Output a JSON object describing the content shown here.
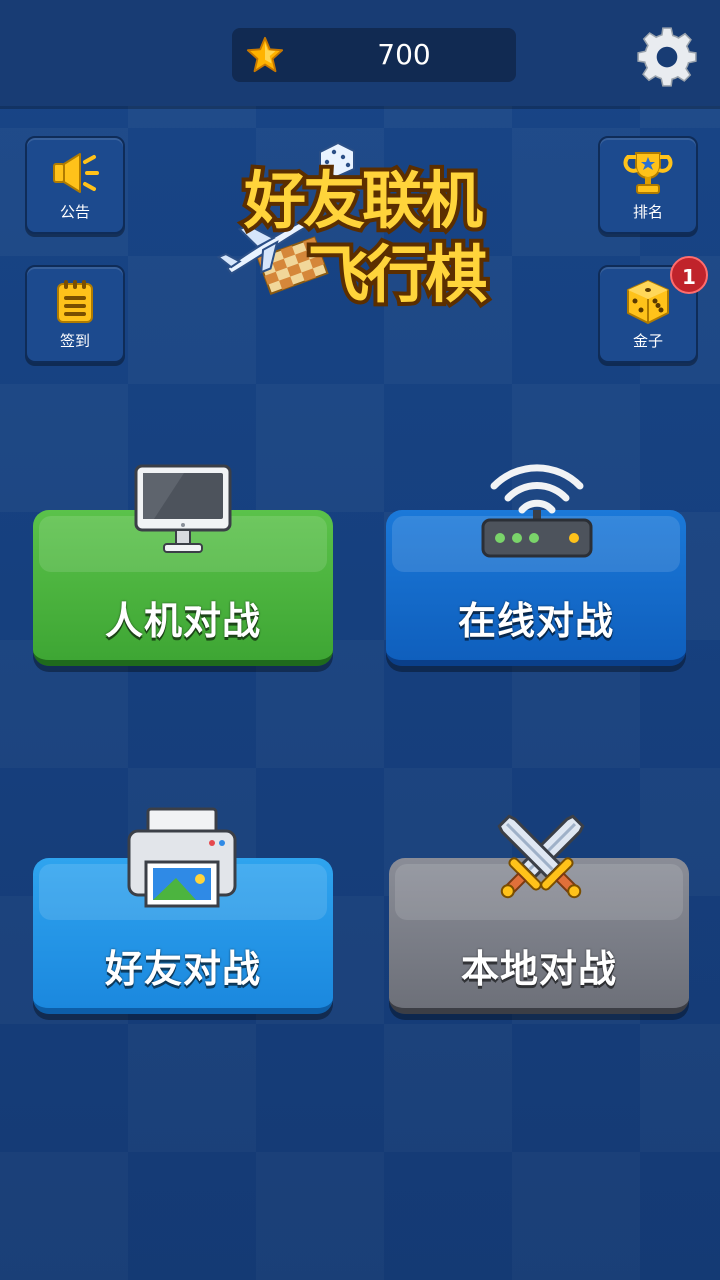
{
  "header": {
    "score": "700",
    "star_icon": "star-icon",
    "settings_icon": "gear-icon"
  },
  "side_buttons": {
    "announcement": {
      "label": "公告",
      "icon": "megaphone-icon"
    },
    "checkin": {
      "label": "签到",
      "icon": "notepad-icon"
    },
    "ranking": {
      "label": "排名",
      "icon": "trophy-icon"
    },
    "gold": {
      "label": "金子",
      "icon": "dice-icon",
      "badge": "1"
    }
  },
  "logo": {
    "line1": "好友联机",
    "line2": "飞行棋"
  },
  "modes": [
    {
      "label": "人机对战",
      "icon": "monitor-icon",
      "color": "#4cb43f"
    },
    {
      "label": "在线对战",
      "icon": "router-icon",
      "color": "#1169cc"
    },
    {
      "label": "好友对战",
      "icon": "printer-icon",
      "color": "#2596e6"
    },
    {
      "label": "本地对战",
      "icon": "crossed-swords-icon",
      "color": "#7b7e87"
    }
  ],
  "colors": {
    "background": "#184587",
    "topbar": "#183c74",
    "badge": "#c0232b",
    "logo_text": "#ffd43b"
  }
}
